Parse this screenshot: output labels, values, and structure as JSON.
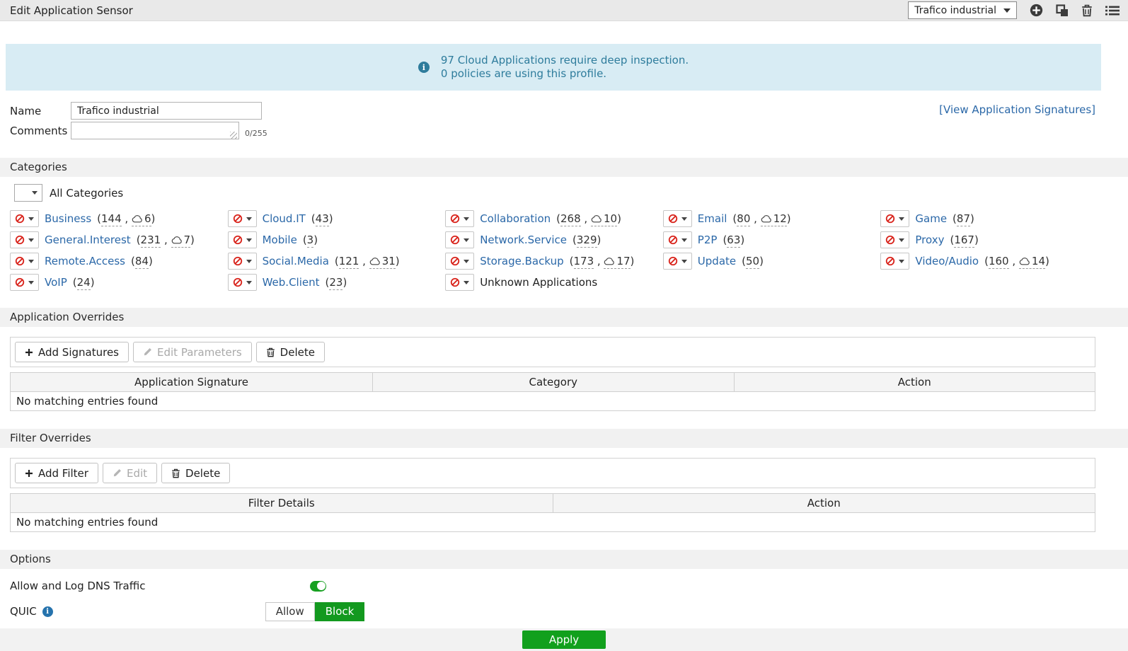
{
  "header": {
    "title": "Edit Application Sensor",
    "profile_select_value": "Trafico industrial",
    "action_icons": [
      "create-new",
      "clone",
      "delete",
      "view-list"
    ]
  },
  "banner": {
    "line1": "97 Cloud Applications require deep inspection.",
    "line2": "0 policies are using this profile.",
    "info_icon": "i"
  },
  "form": {
    "name_label": "Name",
    "name_value": "Trafico industrial",
    "comments_label": "Comments",
    "comments_value": "",
    "comments_counter": "0/255",
    "view_signatures_link": "[View Application Signatures]"
  },
  "categories": {
    "section_title": "Categories",
    "all_categories_label": "All Categories",
    "action_icon": "block-icon",
    "items": [
      {
        "name": "Business",
        "count": 144,
        "cloud": 6,
        "link": true
      },
      {
        "name": "Cloud.IT",
        "count": 43,
        "cloud": null,
        "link": true
      },
      {
        "name": "Collaboration",
        "count": 268,
        "cloud": 10,
        "link": true
      },
      {
        "name": "Email",
        "count": 80,
        "cloud": 12,
        "link": true
      },
      {
        "name": "Game",
        "count": 87,
        "cloud": null,
        "link": true
      },
      {
        "name": "General.Interest",
        "count": 231,
        "cloud": 7,
        "link": true
      },
      {
        "name": "Mobile",
        "count": 3,
        "cloud": null,
        "link": true
      },
      {
        "name": "Network.Service",
        "count": 329,
        "cloud": null,
        "link": true
      },
      {
        "name": "P2P",
        "count": 63,
        "cloud": null,
        "link": true
      },
      {
        "name": "Proxy",
        "count": 167,
        "cloud": null,
        "link": true
      },
      {
        "name": "Remote.Access",
        "count": 84,
        "cloud": null,
        "link": true
      },
      {
        "name": "Social.Media",
        "count": 121,
        "cloud": 31,
        "link": true
      },
      {
        "name": "Storage.Backup",
        "count": 173,
        "cloud": 17,
        "link": true
      },
      {
        "name": "Update",
        "count": 50,
        "cloud": null,
        "link": true
      },
      {
        "name": "Video/Audio",
        "count": 160,
        "cloud": 14,
        "link": true
      },
      {
        "name": "VoIP",
        "count": 24,
        "cloud": null,
        "link": true
      },
      {
        "name": "Web.Client",
        "count": 23,
        "cloud": null,
        "link": true
      },
      {
        "name": "Unknown Applications",
        "count": null,
        "cloud": null,
        "link": false
      }
    ]
  },
  "application_overrides": {
    "section_title": "Application Overrides",
    "toolbar": {
      "add_label": "Add Signatures",
      "edit_label": "Edit Parameters",
      "delete_label": "Delete"
    },
    "table": {
      "headers": [
        "Application Signature",
        "Category",
        "Action"
      ],
      "empty_text": "No matching entries found"
    }
  },
  "filter_overrides": {
    "section_title": "Filter Overrides",
    "toolbar": {
      "add_label": "Add Filter",
      "edit_label": "Edit",
      "delete_label": "Delete"
    },
    "table": {
      "headers": [
        "Filter Details",
        "Action"
      ],
      "empty_text": "No matching entries found"
    }
  },
  "options": {
    "section_title": "Options",
    "dns_label": "Allow and Log DNS Traffic",
    "dns_enabled": true,
    "quic_label": "QUIC",
    "quic_options": [
      "Allow",
      "Block"
    ],
    "quic_selected": "Block"
  },
  "footer": {
    "apply_label": "Apply"
  },
  "colors": {
    "accent_green": "#12a01d",
    "link_blue": "#2b68a8",
    "banner_bg": "#d8ecf4",
    "banner_text": "#2e7c9c",
    "block_red": "#d9251d"
  }
}
